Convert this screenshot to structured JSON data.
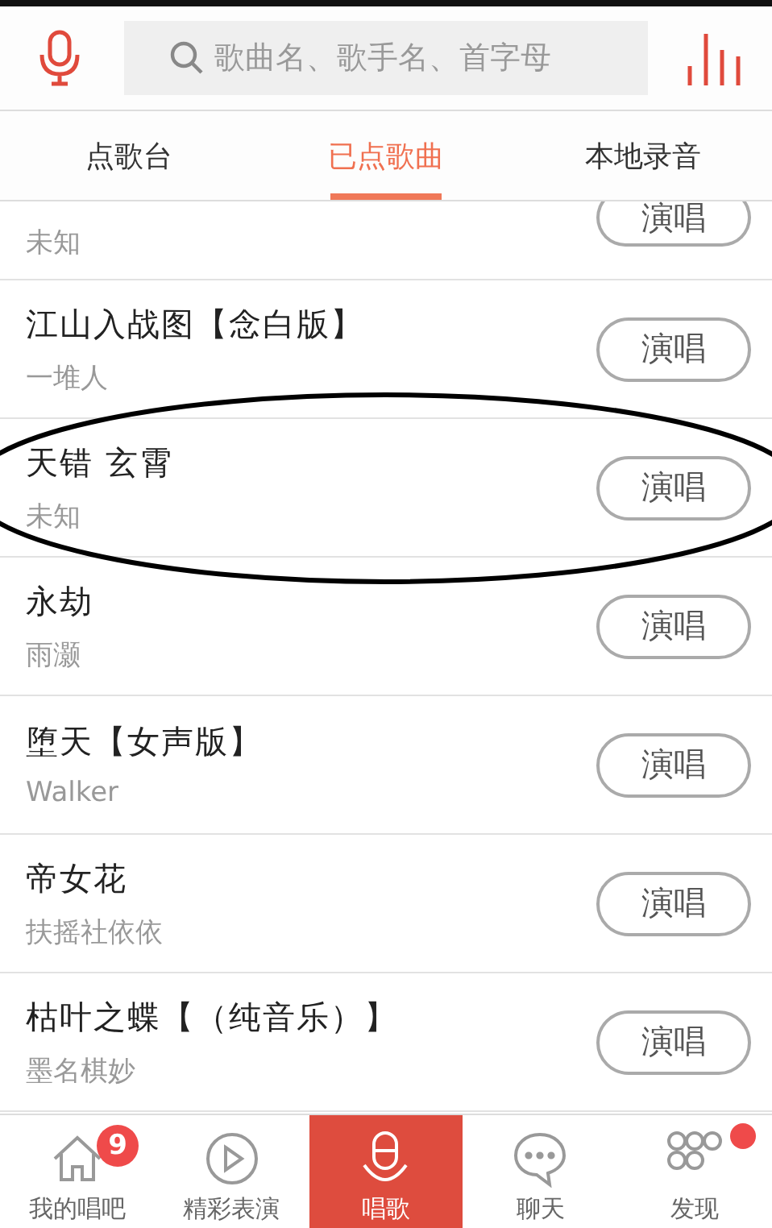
{
  "search": {
    "placeholder": "歌曲名、歌手名、首字母"
  },
  "tabs": [
    {
      "label": "点歌台",
      "selected": false
    },
    {
      "label": "已点歌曲",
      "selected": true
    },
    {
      "label": "本地录音",
      "selected": false
    }
  ],
  "songs": [
    {
      "kind": "partial",
      "artist": "未知",
      "button": "演唱"
    },
    {
      "kind": "full",
      "title": "江山入战图【念白版】",
      "artist": "一堆人",
      "button": "演唱"
    },
    {
      "kind": "full",
      "title": "天错 玄霄",
      "artist": "未知",
      "button": "演唱",
      "circled": true
    },
    {
      "kind": "full",
      "title": "永劫",
      "artist": "雨灏",
      "button": "演唱"
    },
    {
      "kind": "full",
      "title": "堕天【女声版】",
      "artist": "Walker",
      "button": "演唱"
    },
    {
      "kind": "full",
      "title": "帝女花",
      "artist": "扶摇社依依",
      "button": "演唱"
    },
    {
      "kind": "full",
      "title": "枯叶之蝶【（纯音乐）】",
      "artist": "墨名棋妙",
      "button": "演唱"
    }
  ],
  "nav": [
    {
      "label": "我的唱吧",
      "kind": "home",
      "selected": false,
      "badge": "9"
    },
    {
      "label": "精彩表演",
      "kind": "play",
      "selected": false
    },
    {
      "label": "唱歌",
      "kind": "mic",
      "selected": true
    },
    {
      "label": "聊天",
      "kind": "chat",
      "selected": false
    },
    {
      "label": "发现",
      "kind": "grid",
      "selected": false,
      "dot": true
    }
  ]
}
